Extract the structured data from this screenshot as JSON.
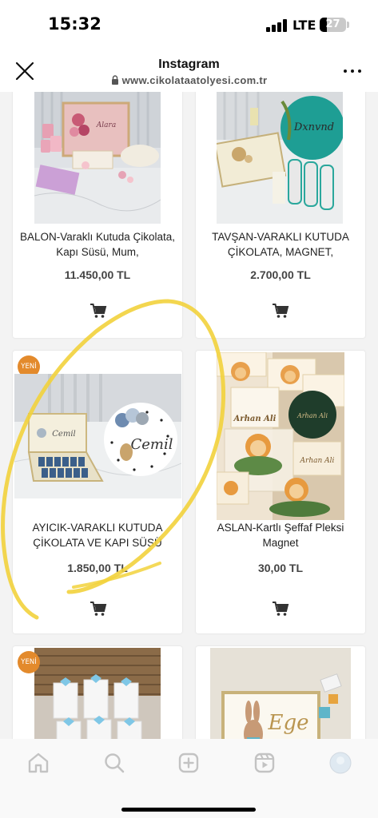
{
  "status_bar": {
    "time": "15:32",
    "network": "LTE",
    "battery": "27",
    "icons": [
      "signal-icon",
      "battery-icon"
    ]
  },
  "browser": {
    "title": "Instagram",
    "url": "www.cikolataatolyesi.com.tr",
    "icons": [
      "close-icon",
      "lock-icon",
      "more-icon"
    ]
  },
  "products": [
    {
      "name": "BALON-Varaklı Kutuda Çikolata, Kapı Süsü, Mum,",
      "price": "11.450,00 TL",
      "badge": ""
    },
    {
      "name": "TAVŞAN-VARAKLI KUTUDA ÇİKOLATA, MAGNET,",
      "price": "2.700,00 TL",
      "badge": ""
    },
    {
      "name": "AYICIK-VARAKLI KUTUDA ÇİKOLATA VE KAPI SÜSÜ",
      "price": "1.850,00 TL",
      "badge": "YENİ"
    },
    {
      "name": "ASLAN-Kartlı Şeffaf Pleksi Magnet",
      "price": "30,00 TL",
      "badge": ""
    },
    {
      "name": "",
      "price": "",
      "badge": "YENİ"
    },
    {
      "name": "",
      "price": "",
      "badge": ""
    }
  ],
  "image_text": {
    "p1": "Alara",
    "p3": "Cemil",
    "p4": "Arhan Ali",
    "p6": "Ege"
  },
  "colors": {
    "badge": "#e38a2c",
    "highlight": "#f2d23c",
    "teal": "#1e9e94"
  },
  "bottom_nav": {
    "items": [
      "home-icon",
      "search-icon",
      "create-icon",
      "reels-icon",
      "profile-icon"
    ]
  }
}
